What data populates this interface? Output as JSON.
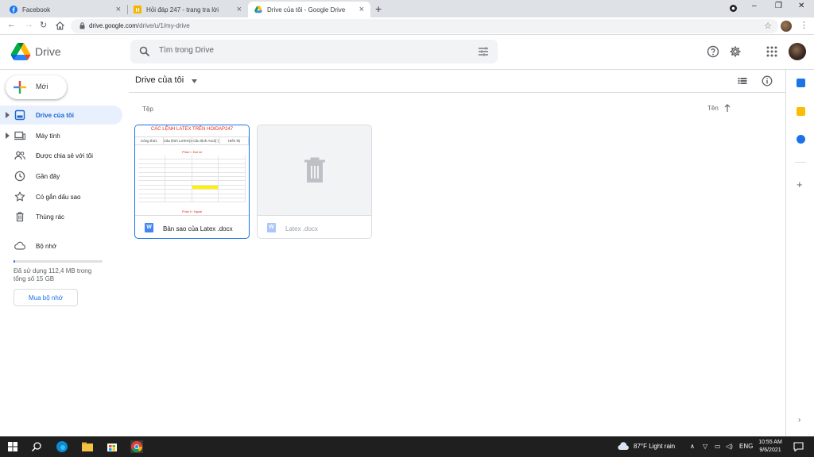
{
  "browser": {
    "tabs": [
      {
        "title": "Facebook"
      },
      {
        "title": "Hỏi đáp 247 - trang tra lời"
      },
      {
        "title": "Drive của tôi - Google Drive"
      }
    ],
    "url_domain": "drive.google.com",
    "url_path": "/drive/u/1/my-drive"
  },
  "header": {
    "brand": "Drive",
    "search_placeholder": "Tìm trong Drive"
  },
  "sidebar": {
    "new_label": "Mới",
    "items": [
      {
        "label": "Drive của tôi"
      },
      {
        "label": "Máy tính"
      },
      {
        "label": "Được chia sẻ với tôi"
      },
      {
        "label": "Gần đây"
      },
      {
        "label": "Có gắn dấu sao"
      },
      {
        "label": "Thùng rác"
      },
      {
        "label": "Bộ nhớ"
      }
    ],
    "storage_used": "Đã sử dụng 112,4 MB trong tổng số 15 GB",
    "storage_fraction": 0.0073,
    "buy_storage": "Mua bộ nhớ"
  },
  "main": {
    "title": "Drive của tôi",
    "section": "Tệp",
    "sort_label": "Tên",
    "files": [
      {
        "name": "Bản sao của Latex .docx",
        "type_icon": "W"
      },
      {
        "name": "Latex .docx",
        "type_icon": "W"
      }
    ],
    "thumbnail": {
      "title": "CÁC LỆNH LATEX TRÊN HOIDAP247",
      "columns": [
        "Công thức",
        "Câu lệnh LaTeX(S)",
        "Câu lệnh Ascii(`)",
        "Hiển thị"
      ],
      "section1": "Phần I: Đại số",
      "section2": "Phần II: Ngoại"
    }
  },
  "taskbar": {
    "weather": "87°F  Light rain",
    "lang": "ENG",
    "time": "10:55 AM",
    "date": "9/6/2021"
  },
  "colors": {
    "accent": "#1a73e8",
    "active_bg": "#e8f0fe",
    "active_text": "#1967d2"
  }
}
